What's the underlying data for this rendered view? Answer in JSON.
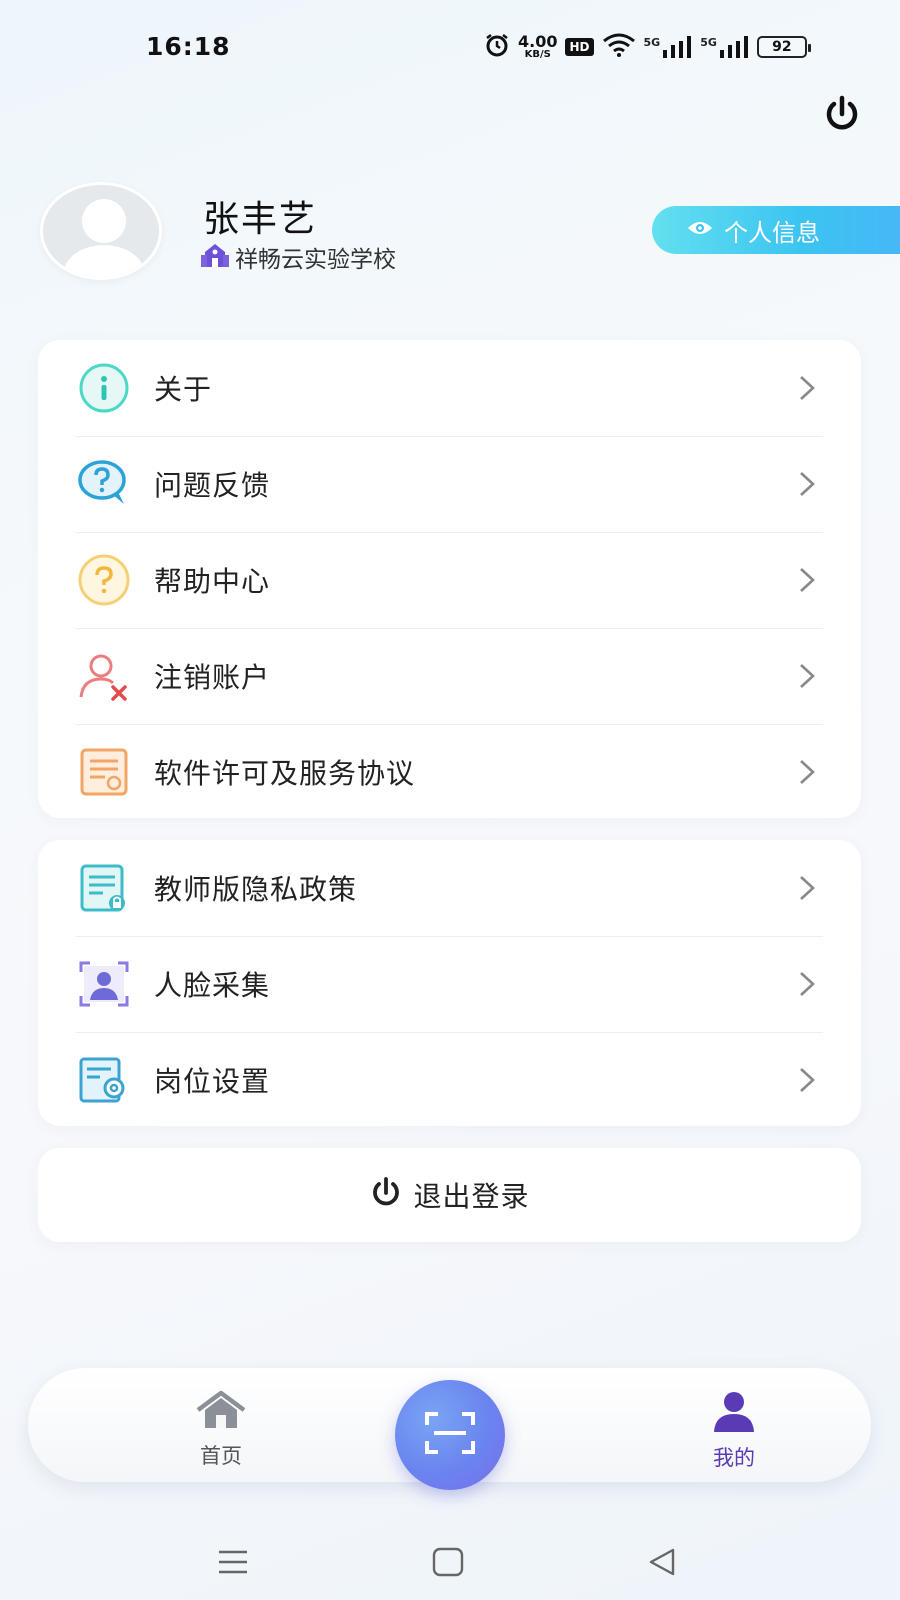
{
  "status_bar": {
    "time": "16:18",
    "net_speed_value": "4.00",
    "net_speed_unit": "KB/S",
    "hd_label": "HD",
    "signal_1_label": "5G",
    "signal_2_label": "5G",
    "battery": "92",
    "icons": [
      "alarm-icon",
      "wifi-icon",
      "signal-icon",
      "battery-icon"
    ]
  },
  "profile": {
    "name": "张丰艺",
    "school": "祥畅云实验学校",
    "info_button_label": "个人信息"
  },
  "menu_group_1": [
    {
      "label": "关于",
      "icon": "info-icon"
    },
    {
      "label": "问题反馈",
      "icon": "feedback-icon"
    },
    {
      "label": "帮助中心",
      "icon": "help-icon"
    },
    {
      "label": "注销账户",
      "icon": "delete-account-icon"
    },
    {
      "label": "软件许可及服务协议",
      "icon": "license-icon"
    }
  ],
  "menu_group_2": [
    {
      "label": "教师版隐私政策",
      "icon": "privacy-icon"
    },
    {
      "label": "人脸采集",
      "icon": "face-capture-icon"
    },
    {
      "label": "岗位设置",
      "icon": "position-settings-icon"
    }
  ],
  "logout_label": "退出登录",
  "tabbar": {
    "home_label": "首页",
    "mine_label": "我的",
    "scan_icon": "scan-icon"
  },
  "colors": {
    "accent_cyan": "#3cc4f1",
    "tab_active": "#5a3bb5",
    "scan_button": "#6a84ef"
  }
}
